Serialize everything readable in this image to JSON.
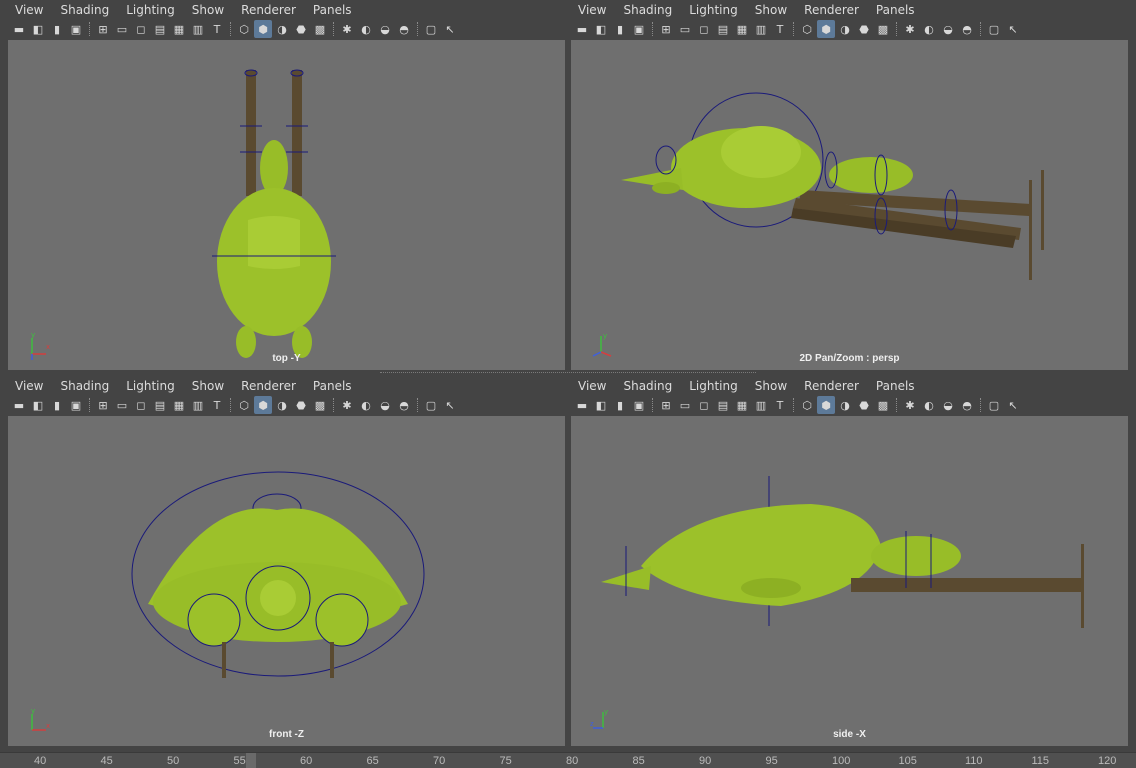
{
  "menus": [
    "View",
    "Shading",
    "Lighting",
    "Show",
    "Renderer",
    "Panels"
  ],
  "toolbar_icons": [
    "camera-icon",
    "camera-attr-icon",
    "bookmark-icon",
    "image-plane-icon",
    "grid-icon",
    "film-gate-icon",
    "resolution-gate-icon",
    "gate-mask-icon",
    "field-chart-icon",
    "safe-action-icon",
    "safe-title-icon",
    "wireframe-icon",
    "smooth-shade-icon",
    "default-material-icon",
    "wireframe-on-shaded-icon",
    "xray-icon",
    "lights-icon",
    "shadows-icon",
    "ssao-icon",
    "motion-blur-icon",
    "isolate-icon",
    "select-camera-icon"
  ],
  "viewports": {
    "top": {
      "label": "top -Y"
    },
    "persp": {
      "label": "2D Pan/Zoom : persp"
    },
    "front": {
      "label": "front -Z"
    },
    "side": {
      "label": "side -X"
    }
  },
  "timeline": {
    "ticks": [
      "40",
      "45",
      "50",
      "55",
      "60",
      "65",
      "70",
      "75",
      "80",
      "85",
      "90",
      "95",
      "100",
      "105",
      "110",
      "115",
      "120"
    ]
  },
  "colors": {
    "viewport_bg": "#6f6f6f",
    "model_green": "#9cc12a",
    "rig_blue": "#1a1a7a",
    "pipe_brown": "#5a4a30"
  }
}
